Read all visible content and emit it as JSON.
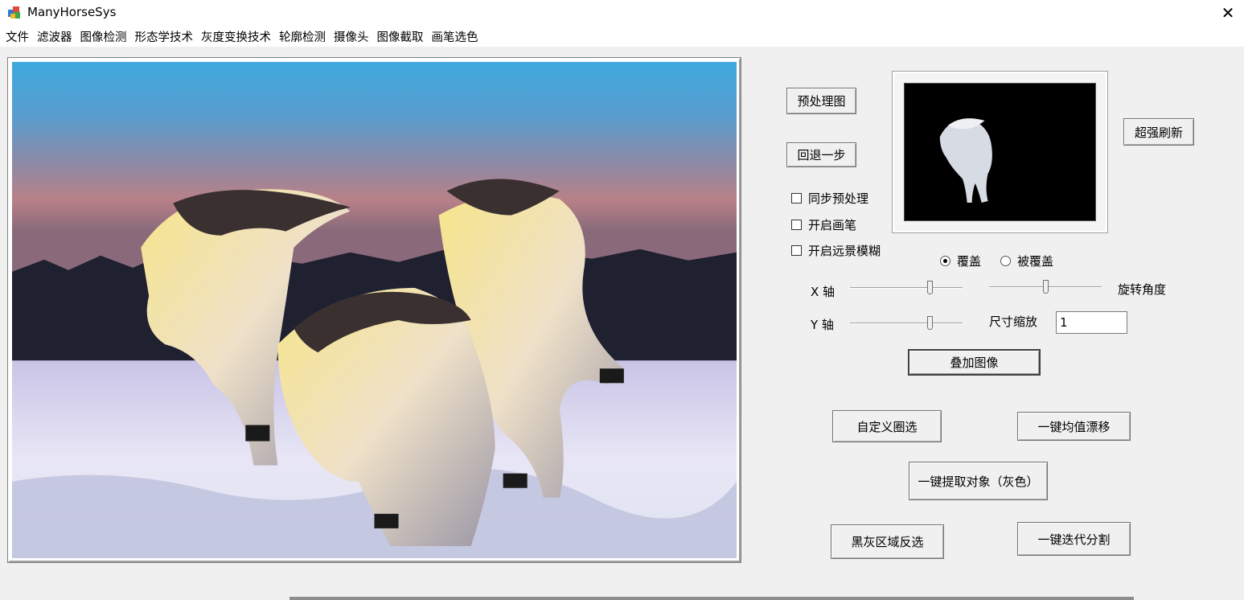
{
  "window": {
    "title": "ManyHorseSys",
    "close_glyph": "✕"
  },
  "menu": [
    "文件",
    "滤波器",
    "图像检测",
    "形态学技术",
    "灰度变换技术",
    "轮廓检测",
    "摄像头",
    "图像截取",
    "画笔选色"
  ],
  "buttons": {
    "preprocess": "预处理图",
    "undo": "回退一步",
    "refresh": "超强刷新",
    "overlay": "叠加图像",
    "custom_select": "自定义圈选",
    "mean_shift": "一键均值漂移",
    "extract_gray": "一键提取对象（灰色）",
    "invert_region": "黑灰区域反选",
    "iterative_segment": "一键迭代分割"
  },
  "checkboxes": [
    {
      "label": "同步预处理",
      "checked": false
    },
    {
      "label": "开启画笔",
      "checked": false
    },
    {
      "label": "开启远景模糊",
      "checked": false
    }
  ],
  "radios": [
    {
      "label": "覆盖",
      "selected": true
    },
    {
      "label": "被覆盖",
      "selected": false
    }
  ],
  "sliders": {
    "x_label": "X 轴",
    "y_label": "Y 轴",
    "rotation_label": "旋转角度",
    "x_value": 0.72,
    "y_value": 0.72,
    "rotation_value": 0.5
  },
  "scale": {
    "label": "尺寸缩放",
    "value": "1"
  }
}
